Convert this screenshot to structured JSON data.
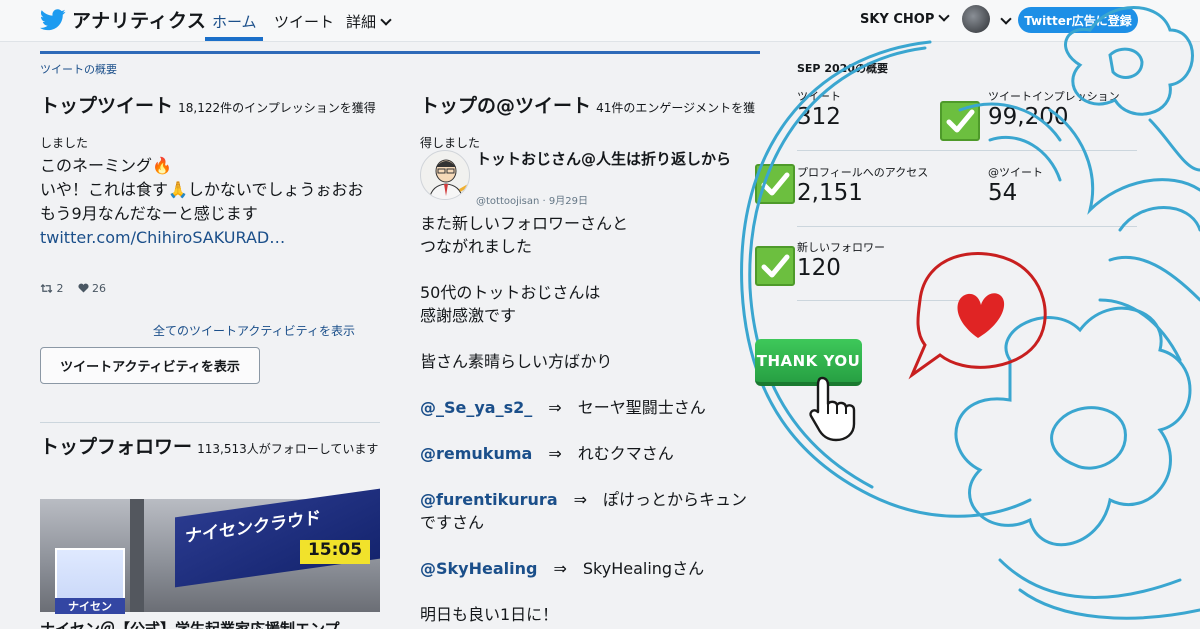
{
  "topnav": {
    "logo_text": "アナリティクス",
    "tabs": [
      {
        "label": "ホーム",
        "active": true
      },
      {
        "label": "ツイート"
      },
      {
        "label": "詳細"
      }
    ],
    "account_name": "SKY CHOP",
    "ads_button": "Twitter広告に登録"
  },
  "overview": {
    "section_label": "ツイートの概要",
    "top_tweet": {
      "title": "トップツイート",
      "subtitle": "18,122件のインプレッションを獲得しました",
      "body": [
        "このネーミング🔥",
        "いや！これは食す🙏しかないでしょうぉおお",
        "もう9月なんだなーと感じます"
      ],
      "link": "twitter.com/ChihiroSAKURAD…",
      "retweets": "2",
      "likes": "26",
      "all_activity_link": "全てのツイートアクティビティを表示",
      "activity_button": "ツイートアクティビティを表示"
    },
    "top_follower": {
      "title": "トップフォロワー",
      "subtitle": "113,513人がフォローしています",
      "image_sign": "ナイセンクラウド",
      "image_clock": "15:05",
      "icon_label": "ナイセン",
      "name": "ナイセン＠【公式】学生起業家応援制エンプ"
    },
    "top_mention": {
      "title": "トップの@ツイート",
      "subtitle": "41件のエンゲージメントを獲得しました",
      "name": "トットおじさん@人生は折り返しから",
      "handle": "@tottoojisan",
      "date": "9月29日",
      "lines": [
        {
          "text": "また新しいフォロワーさんと"
        },
        {
          "text": "つながれました"
        },
        {
          "text": ""
        },
        {
          "text": "50代のトットおじさんは"
        },
        {
          "text": "感謝感激です"
        },
        {
          "text": ""
        },
        {
          "text": "皆さん素晴らしい方ばかり"
        },
        {
          "text": ""
        },
        {
          "handle": "@_Se_ya_s2_",
          "text": "⇒　セーヤ聖闘士さん"
        },
        {
          "text": ""
        },
        {
          "handle": "@remukuma",
          "text": "⇒　れむクマさん"
        },
        {
          "text": ""
        },
        {
          "handle": "@furentikurura",
          "text": "⇒　ぽけっとからキュン"
        },
        {
          "text": "ですさん"
        },
        {
          "text": ""
        },
        {
          "handle": "@SkyHealing",
          "text": "⇒　SkyHealingさん"
        },
        {
          "text": ""
        },
        {
          "text": "明日も良い1日に！"
        }
      ]
    }
  },
  "summary": {
    "period_label": "SEP 2020の概要",
    "metrics": [
      {
        "label": "ツイート",
        "value": "312"
      },
      {
        "label": "ツイートインプレッション",
        "value": "99,200"
      },
      {
        "label": "プロフィールへのアクセス",
        "value": "2,151"
      },
      {
        "label": "@ツイート",
        "value": "54"
      },
      {
        "label": "新しいフォロワー",
        "value": "120"
      }
    ],
    "thank_button": "THANK YOU"
  },
  "colors": {
    "accent": "#1b4f8a",
    "ads_button": "#1d8fe6",
    "check": "#6cbf3f",
    "heart": "#e02424",
    "decoration": "#3aa6d0"
  }
}
